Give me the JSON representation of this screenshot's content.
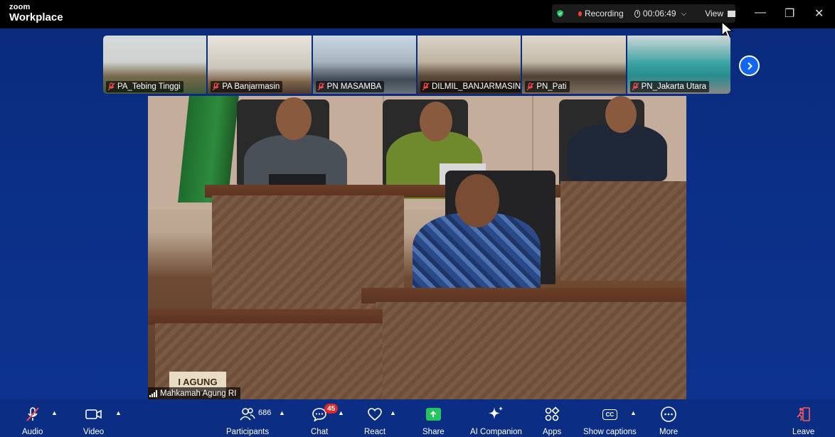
{
  "app": {
    "brand_small": "zoom",
    "brand_big": "Workplace"
  },
  "topbar": {
    "recording_label": "Recording",
    "timer": "00:06:49",
    "view_label": "View"
  },
  "thumbnails": [
    {
      "name": "PA_Tebing Tinggi",
      "muted": true
    },
    {
      "name": "PA Banjarmasin",
      "muted": true
    },
    {
      "name": "PN MASAMBA",
      "muted": true
    },
    {
      "name": "DILMIL_BANJARMASIN",
      "muted": true
    },
    {
      "name": "PN_Pati",
      "muted": true
    },
    {
      "name": "PN_Jakarta Utara",
      "muted": true
    }
  ],
  "main_video": {
    "speaker_name": "Mahkamah Agung RI",
    "sign_text": "I AGUNG"
  },
  "toolbar": {
    "audio": "Audio",
    "video": "Video",
    "participants": "Participants",
    "participants_count": "686",
    "chat": "Chat",
    "chat_badge": "45",
    "react": "React",
    "share": "Share",
    "ai_companion": "AI Companion",
    "apps": "Apps",
    "captions": "Show captions",
    "more": "More",
    "leave": "Leave"
  },
  "colors": {
    "background": "#0b2f86",
    "share_green": "#22c55e",
    "recording_red": "#ff3b30",
    "badge_red": "#e02828",
    "next_blue": "#1366f0"
  }
}
